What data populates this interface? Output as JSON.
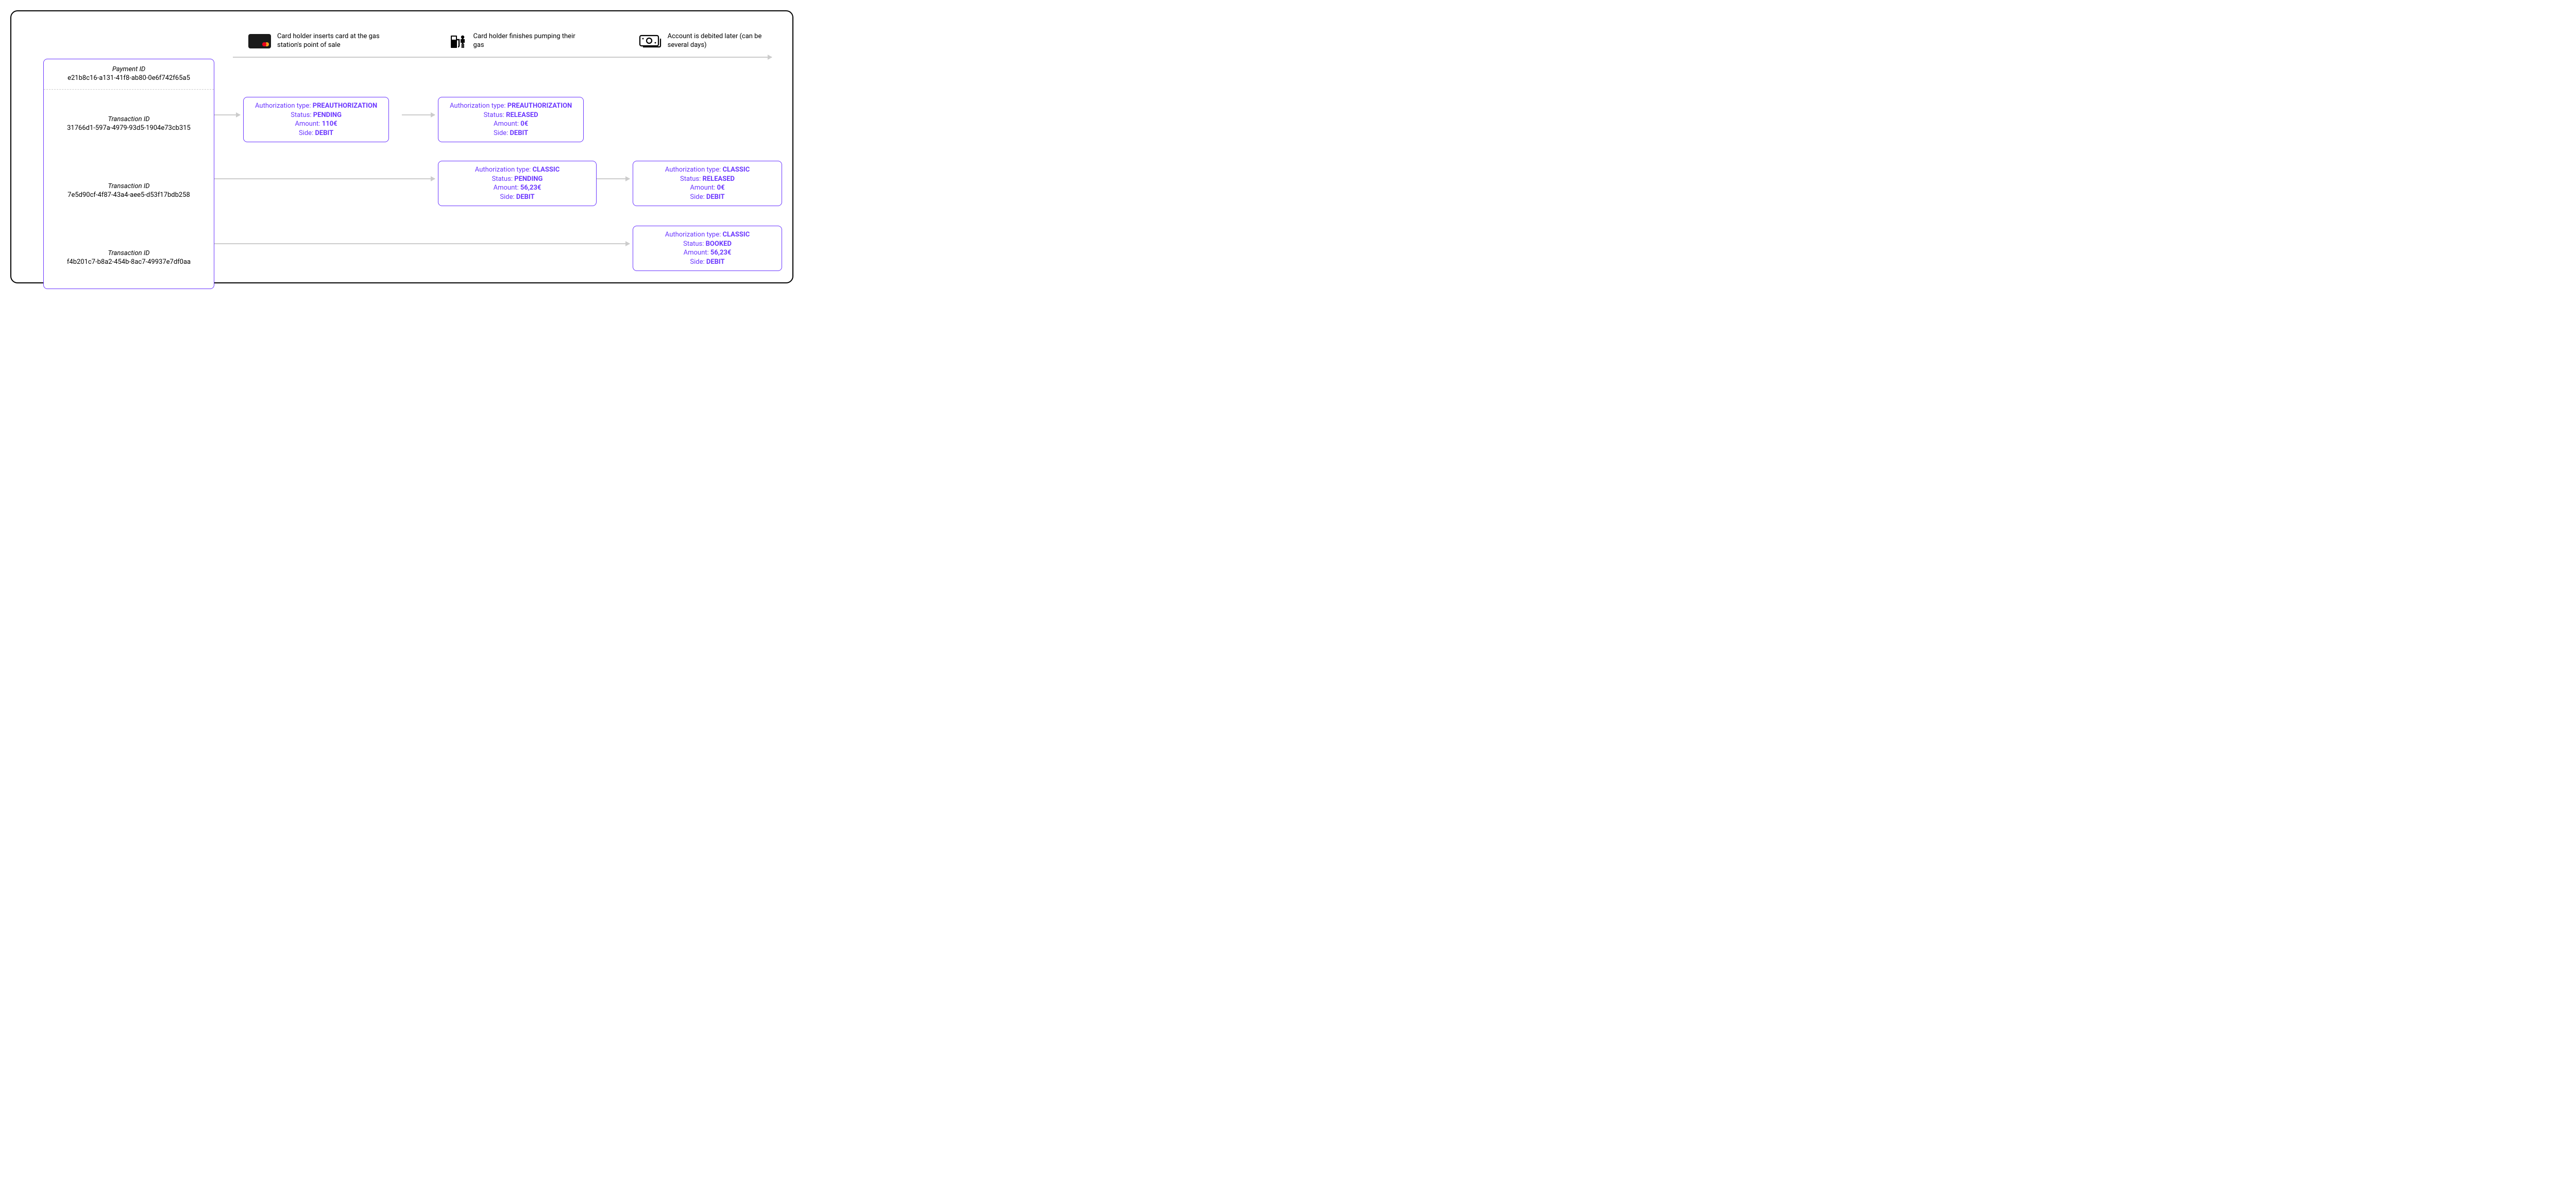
{
  "events": [
    {
      "icon": "card-icon",
      "text": "Card holder inserts card at the gas station's point of sale"
    },
    {
      "icon": "gas-pump-icon",
      "text": "Card holder finishes pumping their gas"
    },
    {
      "icon": "cash-icon",
      "text": "Account is debited later (can be several days)"
    }
  ],
  "payment": {
    "label": "Payment ID",
    "value": "e21b8c16-a131-41f8-ab80-0e6f742f65a5"
  },
  "transactions": [
    {
      "label": "Transaction ID",
      "value": "31766d1-597a-4979-93d5-1904e73cb315"
    },
    {
      "label": "Transaction ID",
      "value": "7e5d90cf-4f87-43a4-aee5-d53f17bdb258"
    },
    {
      "label": "Transaction ID",
      "value": "f4b201c7-b8a2-454b-8ac7-49937e7df0aa"
    }
  ],
  "field_labels": {
    "auth_type": "Authorization type: ",
    "status": "Status: ",
    "amount": "Amount: ",
    "side": "Side: "
  },
  "cards": {
    "r1c1": {
      "auth_type": "PREAUTHORIZATION",
      "status": "PENDING",
      "amount": "110€",
      "side": "DEBIT"
    },
    "r1c2": {
      "auth_type": "PREAUTHORIZATION",
      "status": "RELEASED",
      "amount": "0€",
      "side": "DEBIT"
    },
    "r2c2": {
      "auth_type": "CLASSIC",
      "status": "PENDING",
      "amount": "56,23€",
      "side": "DEBIT"
    },
    "r2c3": {
      "auth_type": "CLASSIC",
      "status": "RELEASED",
      "amount": "0€",
      "side": "DEBIT"
    },
    "r3c3": {
      "auth_type": "CLASSIC",
      "status": "BOOKED",
      "amount": "56,23€",
      "side": "DEBIT"
    }
  }
}
